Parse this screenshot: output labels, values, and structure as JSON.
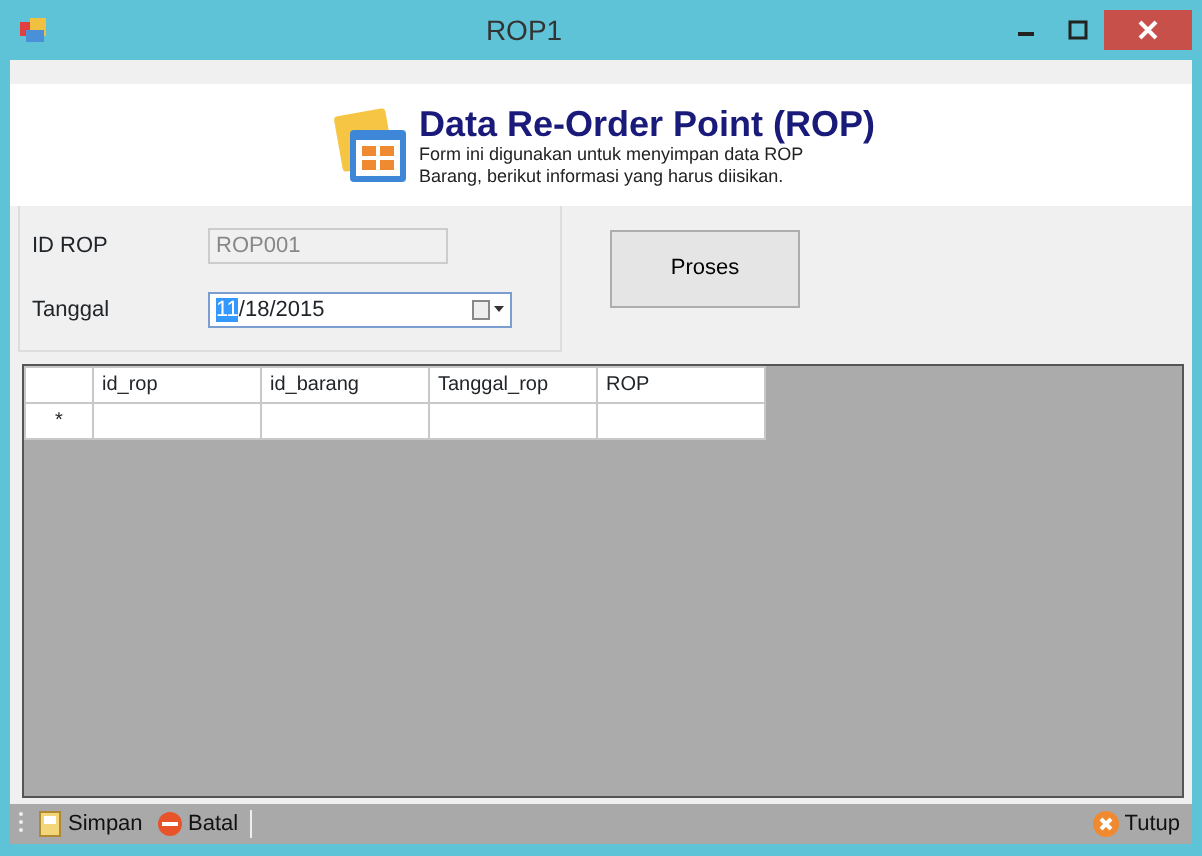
{
  "window": {
    "title": "ROP1"
  },
  "header": {
    "title": "Data Re-Order Point (ROP)",
    "description": "Form ini digunakan untuk menyimpan data ROP Barang, berikut informasi yang harus diisikan."
  },
  "form": {
    "id_label": "ID ROP",
    "id_value": "ROP001",
    "id_disabled": true,
    "date_label": "Tanggal",
    "date_selected_part": "11",
    "date_rest": "/18/2015"
  },
  "process_button": "Proses",
  "table": {
    "columns": [
      "id_rop",
      "id_barang",
      "Tanggal_rop",
      "ROP"
    ],
    "new_row_marker": "*"
  },
  "toolbar": {
    "left": [
      {
        "kind": "save",
        "label": "Simpan"
      },
      {
        "kind": "cancel",
        "label": "Batal"
      }
    ],
    "right": [
      {
        "kind": "close",
        "label": "Tutup"
      }
    ]
  }
}
